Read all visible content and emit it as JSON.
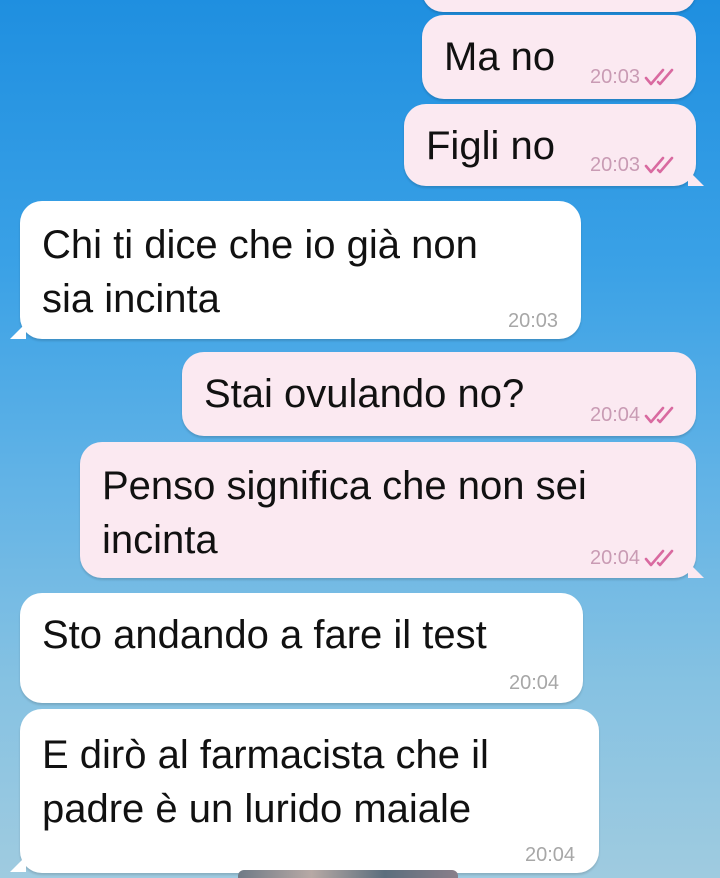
{
  "chat": {
    "messages": [
      {
        "text": "Ma no",
        "time": "20:03",
        "direction": "outgoing",
        "status": "read"
      },
      {
        "text": "Figli no",
        "time": "20:03",
        "direction": "outgoing",
        "status": "read"
      },
      {
        "text_lines": [
          "Chi ti dice che io già non",
          "sia incinta"
        ],
        "time": "20:03",
        "direction": "incoming"
      },
      {
        "text": "Stai ovulando no?",
        "time": "20:04",
        "direction": "outgoing",
        "status": "read"
      },
      {
        "text_lines": [
          "Penso significa che non sei",
          "incinta"
        ],
        "time": "20:04",
        "direction": "outgoing",
        "status": "read"
      },
      {
        "text": "Sto andando a fare il test",
        "time": "20:04",
        "direction": "incoming"
      },
      {
        "text_lines": [
          "E dirò al farmacista che il",
          "padre è un lurido maiale"
        ],
        "time": "20:04",
        "direction": "incoming"
      }
    ]
  },
  "colors": {
    "outgoing_bubble": "#fbe9f1",
    "incoming_bubble": "#ffffff",
    "read_check": "#d96aa0",
    "background_top": "#1f8fe0",
    "background_bottom": "#9fcbe0"
  },
  "icons": {
    "read_status": "double-check-icon"
  }
}
